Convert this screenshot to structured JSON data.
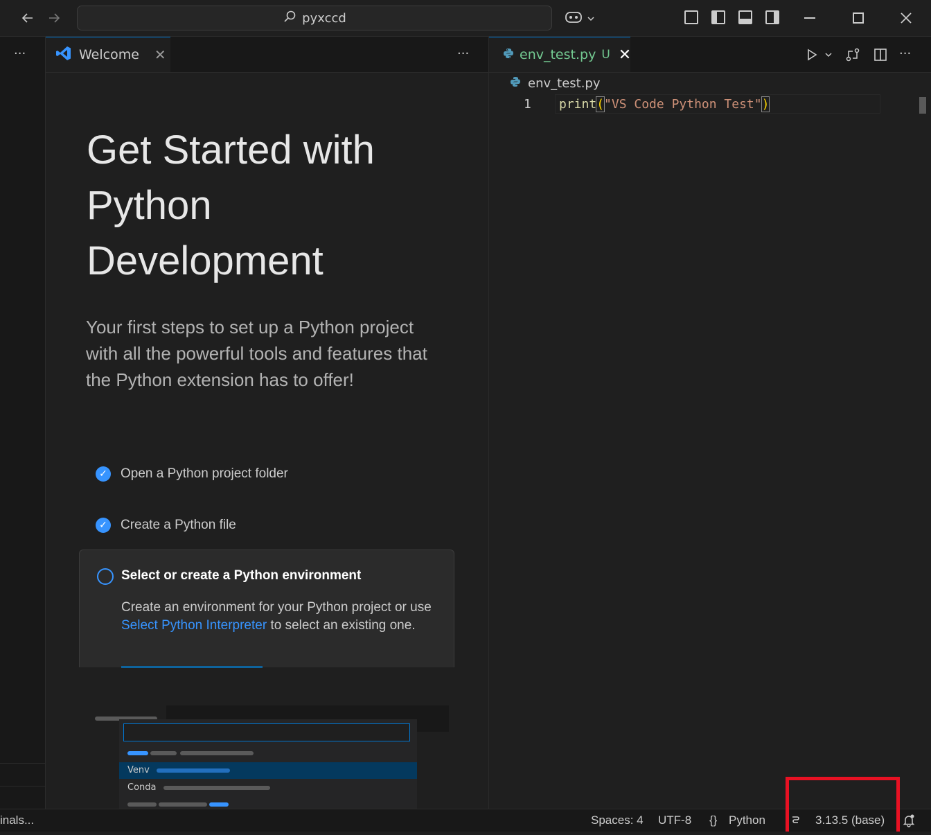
{
  "titlebar": {
    "search_text": "pyxccd",
    "back_icon": "arrow-left-icon",
    "forward_icon": "arrow-right-icon",
    "copilot_icon": "copilot-icon"
  },
  "editor_left": {
    "tab_label": "Welcome",
    "tab_close": "✕",
    "more": "···",
    "welcome": {
      "title": "Get Started with Python Development",
      "subtitle": "Your first steps to set up a Python project with all the powerful tools and features that the Python extension has to offer!",
      "steps": [
        {
          "label": "Open a Python project folder",
          "done": true
        },
        {
          "label": "Create a Python file",
          "done": true
        },
        {
          "label": "Select or create a Python environment",
          "done": false
        }
      ],
      "active_step": {
        "title": "Select or create a Python environment",
        "desc_before": "Create an environment for your Python project or use ",
        "desc_link": "Select Python Interpreter",
        "desc_after": " to select an existing one."
      },
      "illustration": {
        "items": [
          "Venv",
          "Conda"
        ]
      }
    }
  },
  "editor_right": {
    "tab_label": "env_test.py",
    "tab_status": "U",
    "tab_close": "✕",
    "breadcrumb": "env_test.py",
    "line_number": "1",
    "code": {
      "fn": "print",
      "open": "(",
      "str": "\"VS Code Python Test\"",
      "close": ")"
    },
    "more": "···"
  },
  "left_strip": {
    "more": "···"
  },
  "statusbar": {
    "left_text": "inals...",
    "spaces": "Spaces: 4",
    "encoding": "UTF-8",
    "language_icon": "{}",
    "language": "Python",
    "interpreter": "3.13.5 (base)"
  },
  "colors": {
    "accent": "#0078d4",
    "link": "#3794ff",
    "highlight": "#e81123",
    "untracked": "#73c991"
  }
}
